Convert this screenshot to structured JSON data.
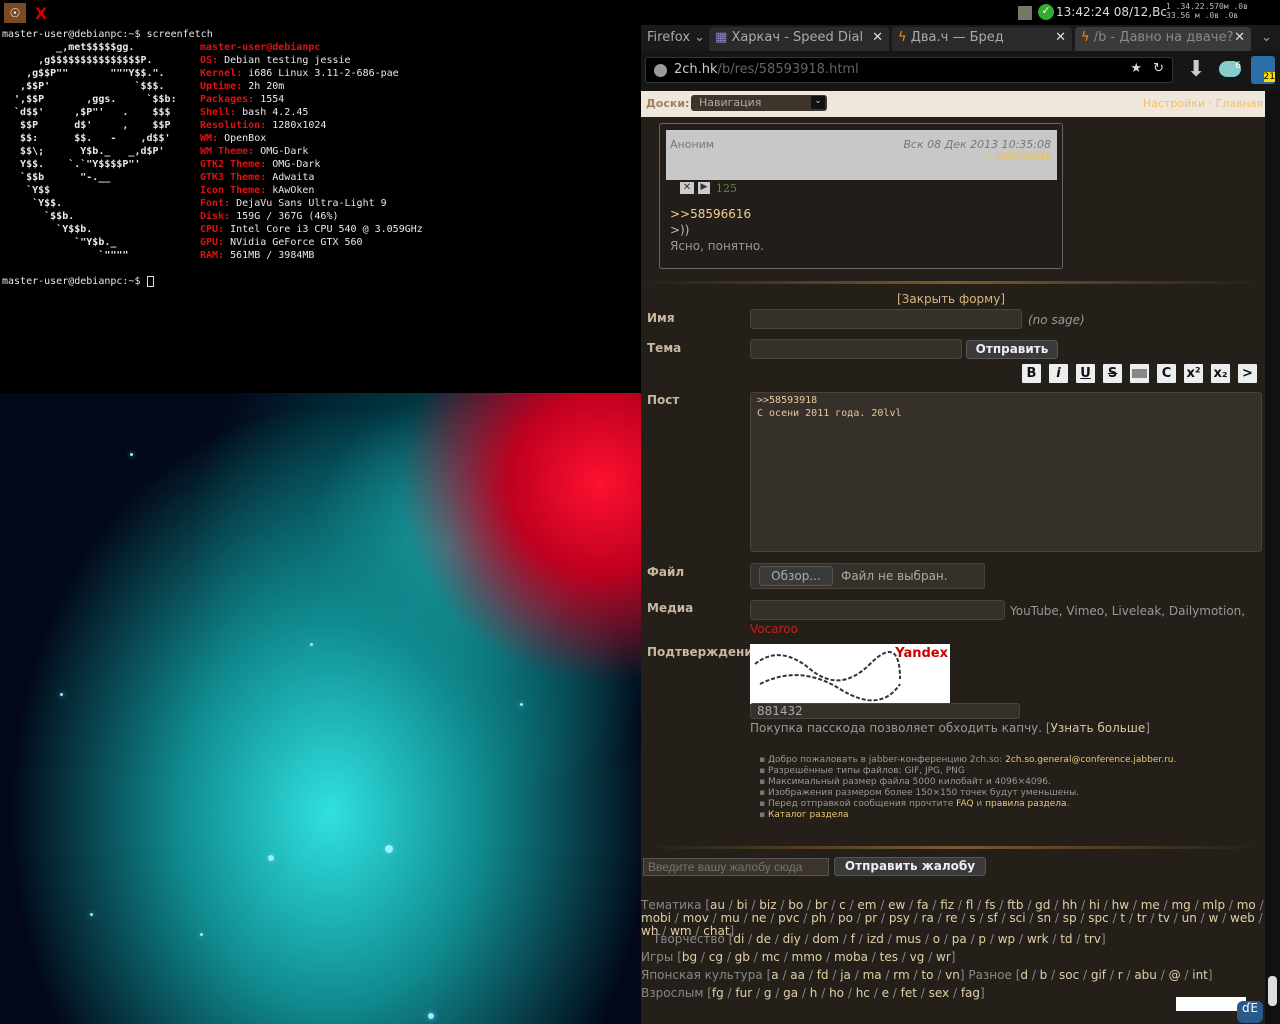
{
  "topbar": {
    "apps": [
      "debian-app",
      "X"
    ],
    "clock": "13:42:24 08/12,Вс",
    "net": [
      "1   .34.22.570м .0в",
      "33.56 м .0в    .0в"
    ]
  },
  "terminal": {
    "cmd": "master-user@debianpc:~$ screenfetch",
    "prompt": "master-user@debianpc:~$ ",
    "art": [
      "         _,met$$$$$gg.",
      "      ,g$$$$$$$$$$$$$$$P.",
      "    ,g$$P\"\"       \"\"\"Y$$.\".",
      "   ,$$P'              `$$$.",
      "  ',$$P       ,ggs.     `$$b:",
      "  `d$$'     ,$P\"'   .    $$$",
      "   $$P      d$'     ,    $$P",
      "   $$:      $$.   -    ,d$$'",
      "   $$\\;      Y$b._   _,d$P'",
      "   Y$$.    `.`\"Y$$$$P\"'",
      "   `$$b      \"-.__",
      "    `Y$$",
      "     `Y$$.",
      "       `$$b.",
      "         `Y$$b.",
      "            `\"Y$b._",
      "                `\"\"\"\""
    ],
    "user": "master-user@debianpc",
    "info": [
      [
        "OS:",
        "Debian testing jessie"
      ],
      [
        "Kernel:",
        "i686 Linux 3.11-2-686-pae"
      ],
      [
        "Uptime:",
        "2h 20m"
      ],
      [
        "Packages:",
        "1554"
      ],
      [
        "Shell:",
        "bash 4.2.45"
      ],
      [
        "Resolution:",
        "1280x1024"
      ],
      [
        "WM:",
        "OpenBox"
      ],
      [
        "WM Theme:",
        "OMG-Dark"
      ],
      [
        "GTK2 Theme:",
        "OMG-Dark"
      ],
      [
        "GTK3 Theme:",
        "Adwaita"
      ],
      [
        "Icon Theme:",
        "kAwOken"
      ],
      [
        "Font:",
        "DejaVu Sans Ultra-Light 9"
      ],
      [
        "Disk:",
        "159G / 367G (46%)"
      ],
      [
        "CPU:",
        "Intel Core i3 CPU 540 @ 3.059GHz"
      ],
      [
        "GPU:",
        "NVidia GeForce GTX 560"
      ],
      [
        "RAM:",
        "561MB / 3984MB"
      ]
    ]
  },
  "firefox": {
    "menu": "Firefox",
    "tabs": [
      "Харкач - Speed Dial",
      "Два.ч — Бред",
      "/b - Давно на дваче?"
    ],
    "url_host": "2ch.hk",
    "url_path": "/b/res/58593918.html",
    "badge": "21",
    "badge2": "6"
  },
  "page": {
    "boards_label": "Доски:",
    "nav_select": "Навигация",
    "settings": "Настройки",
    "home": "Главная",
    "post": {
      "author": "Аноним",
      "date": "Вск 08 Дек 2013 10:35:08",
      "num": "№58596616",
      "score": "125",
      "lines": [
        ">>58596616",
        ">))",
        "Ясно, понятно."
      ]
    },
    "form": {
      "close": "[Закрыть форму]",
      "name": "Имя",
      "nosage": "(no sage)",
      "subject": "Тема",
      "send": "Отправить",
      "fmt": [
        "B",
        "i",
        "U",
        "S",
        "",
        "C",
        "x²",
        "x₂",
        ">"
      ],
      "post_label": "Пост",
      "post_text": ">>58593918\nС осени 2011 года. 20lvl",
      "file": "Файл",
      "browse": "Обзор...",
      "nofile": "Файл не выбран.",
      "media": "Медиа",
      "media_hint": "YouTube, Vimeo, Liveleak, Dailymotion,",
      "vocaroo": "Vocaroo",
      "captcha_label": "Подтверждение",
      "captcha_brand": "Yandex",
      "captcha_value": "881432",
      "passcode": "Покупка пасскода позволяет обходить капчу. [",
      "learn": "Узнать больше",
      "passcode_end": "]"
    },
    "rules": [
      [
        "Добро пожаловать в jabber-конференцию 2ch.so: ",
        "2ch.so.general@conference.jabber.ru",
        "."
      ],
      [
        "Разрешённые типы файлов: GIF, JPG, PNG",
        "",
        ""
      ],
      [
        "Максимальный размер файла 5000 килобайт и 4096×4096.",
        "",
        ""
      ],
      [
        "Изображения размером более 150×150 точек будут уменьшены.",
        "",
        ""
      ],
      [
        "Перед отправкой сообщения прочтите ",
        "FAQ",
        " и "
      ],
      [
        "",
        "Каталог раздела",
        ""
      ]
    ],
    "rules_extra": "правила раздела",
    "complaint_placeholder": "Введите вашу жалобу сюда",
    "complaint_send": "Отправить жалобу",
    "boards": [
      {
        "cat": "Тематика",
        "list": [
          "au",
          "bi",
          "biz",
          "bo",
          "br",
          "c",
          "em",
          "ew",
          "fa",
          "fiz",
          "fl",
          "fs",
          "ftb",
          "gd",
          "hh",
          "hi",
          "hw",
          "me",
          "mg",
          "mlp",
          "mo",
          "mobi",
          "mov",
          "mu",
          "ne",
          "pvc",
          "ph",
          "po",
          "pr",
          "psy",
          "ra",
          "re",
          "s",
          "sf",
          "sci",
          "sn",
          "sp",
          "spc",
          "t",
          "tr",
          "tv",
          "un",
          "w",
          "web",
          "wh",
          "wm",
          "chat"
        ]
      },
      {
        "cat": "Творчество",
        "list": [
          "di",
          "de",
          "diy",
          "dom",
          "f",
          "izd",
          "mus",
          "o",
          "pa",
          "p",
          "wp",
          "wrk",
          "td",
          "trv"
        ]
      },
      {
        "cat": "Игры",
        "list": [
          "bg",
          "cg",
          "gb",
          "mc",
          "mmo",
          "moba",
          "tes",
          "vg",
          "wr"
        ]
      },
      {
        "cat": "Японская культура",
        "list": [
          "a",
          "aa",
          "fd",
          "ja",
          "ma",
          "rm",
          "to",
          "vn"
        ]
      },
      {
        "cat": "Разное",
        "list": [
          "d",
          "b",
          "soc",
          "gif",
          "r",
          "abu",
          "@",
          "int"
        ]
      },
      {
        "cat": "Взрослым",
        "list": [
          "fg",
          "fur",
          "g",
          "ga",
          "h",
          "ho",
          "hc",
          "e",
          "fet",
          "sex",
          "fag"
        ]
      }
    ]
  }
}
